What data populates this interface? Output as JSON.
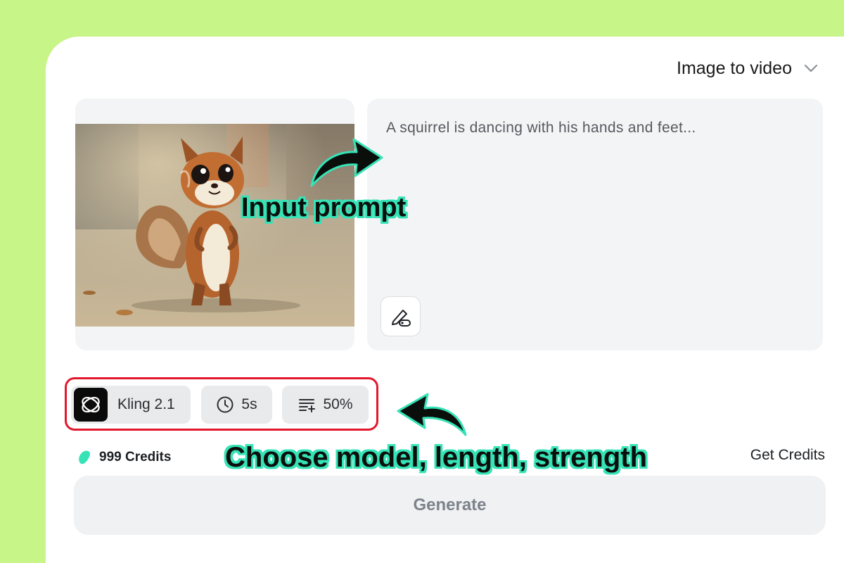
{
  "mode_select": {
    "label": "Image to video",
    "icon": "chevron-down-icon"
  },
  "prompt": {
    "text": "A squirrel is dancing with his hands and feet..."
  },
  "annotations": {
    "prompt_hint": "Input prompt",
    "options_hint": "Choose model, length, strength"
  },
  "options": {
    "model": {
      "label": "Kling 2.1",
      "icon": "kling-logo-icon"
    },
    "length": {
      "label": "5s",
      "icon": "clock-icon"
    },
    "strength": {
      "label": "50%",
      "icon": "strength-lines-icon"
    }
  },
  "credits": {
    "label": "999 Credits",
    "icon": "bean-icon",
    "color": "#36e3b6"
  },
  "get_credits": "Get Credits",
  "generate": {
    "label": "Generate"
  },
  "colors": {
    "page_bg": "#c8f587",
    "accent": "#36e3b6",
    "highlight": "#e3172c"
  }
}
